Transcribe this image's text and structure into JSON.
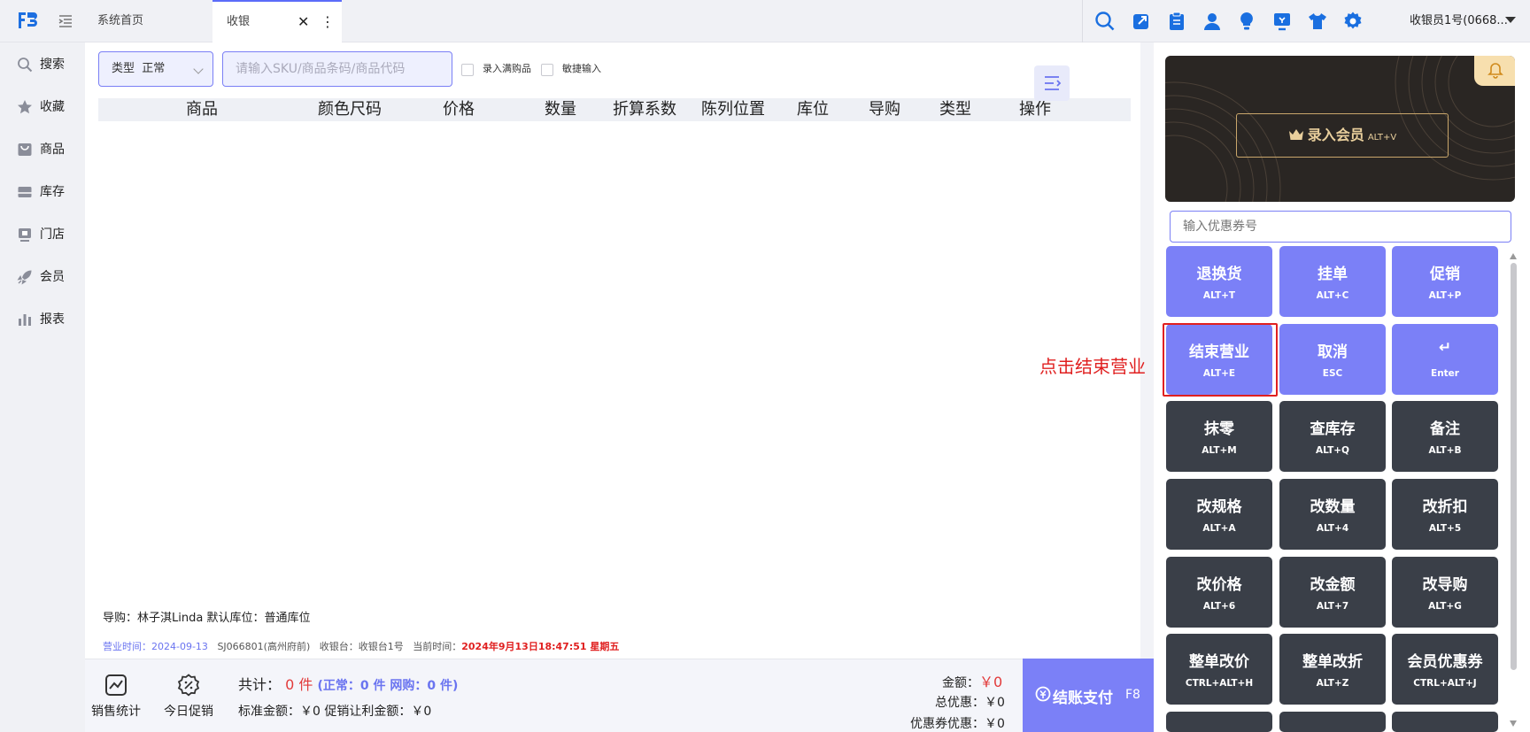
{
  "tabs": {
    "home": "系统首页",
    "active": "收银",
    "close": "✕",
    "more": "⋮"
  },
  "user": {
    "name": "收银员1号(0668..."
  },
  "sidebar": {
    "items": [
      {
        "label": "搜索",
        "icon": "search-icon"
      },
      {
        "label": "收藏",
        "icon": "star-icon"
      },
      {
        "label": "商品",
        "icon": "bag-icon"
      },
      {
        "label": "库存",
        "icon": "inventory-icon"
      },
      {
        "label": "门店",
        "icon": "store-icon"
      },
      {
        "label": "会员",
        "icon": "rocket-icon"
      },
      {
        "label": "报表",
        "icon": "bar-chart-icon"
      }
    ]
  },
  "toolbar": {
    "type_label": "类型",
    "type_value": "正常",
    "sku_placeholder": "请输入SKU/商品条码/商品代码",
    "check_full_gift": "录入满购品",
    "check_quick": "敏捷输入"
  },
  "table": {
    "headers": [
      "商品",
      "颜色尺码",
      "价格",
      "数量",
      "折算系数",
      "陈列位置",
      "库位",
      "导购",
      "类型",
      "操作"
    ]
  },
  "info": {
    "guide": "导购：林子淇Linda   默认库位：普通库位",
    "business_time_label": "营业时间：",
    "business_time": "2024-09-13",
    "store": "SJ066801(高州府前)",
    "register": "收银台：收银台1号",
    "current_time_label": "当前时间：",
    "current_time": "2024年9月13日18:47:51 星期五"
  },
  "bottom": {
    "sales_stats": "销售统计",
    "today_promo": "今日促销",
    "total_label": "共计：",
    "total_count": "0 件",
    "total_detail": "(正常：0 件  网购：0 件)",
    "standard_amount": "标准金额：￥0  促销让利金额：￥0",
    "amount_label": "金额：",
    "amount_value": "￥0",
    "total_discount_label": "总优惠：",
    "total_discount_value": "￥0",
    "coupon_discount_label": "优惠券优惠：",
    "coupon_discount_value": "￥0",
    "pay_label": "结账支付",
    "pay_key": "F8"
  },
  "right": {
    "member_label": "录入会员",
    "member_key": "ALT+V",
    "coupon_placeholder": "输入优惠券号",
    "keys": [
      {
        "label": "退换货",
        "key": "ALT+T",
        "style": "p"
      },
      {
        "label": "挂单",
        "key": "ALT+C",
        "style": "p"
      },
      {
        "label": "促销",
        "key": "ALT+P",
        "style": "p"
      },
      {
        "label": "结束营业",
        "key": "ALT+E",
        "style": "p"
      },
      {
        "label": "取消",
        "key": "ESC",
        "style": "p"
      },
      {
        "label": "↵",
        "key": "Enter",
        "style": "p"
      },
      {
        "label": "抹零",
        "key": "ALT+M",
        "style": "d"
      },
      {
        "label": "查库存",
        "key": "ALT+Q",
        "style": "d"
      },
      {
        "label": "备注",
        "key": "ALT+B",
        "style": "d"
      },
      {
        "label": "改规格",
        "key": "ALT+A",
        "style": "d"
      },
      {
        "label": "改数量",
        "key": "ALT+4",
        "style": "d"
      },
      {
        "label": "改折扣",
        "key": "ALT+5",
        "style": "d"
      },
      {
        "label": "改价格",
        "key": "ALT+6",
        "style": "d"
      },
      {
        "label": "改金额",
        "key": "ALT+7",
        "style": "d"
      },
      {
        "label": "改导购",
        "key": "ALT+G",
        "style": "d"
      },
      {
        "label": "整单改价",
        "key": "CTRL+ALT+H",
        "style": "d"
      },
      {
        "label": "整单改折",
        "key": "ALT+Z",
        "style": "d"
      },
      {
        "label": "会员优惠券",
        "key": "CTRL+ALT+J",
        "style": "d"
      }
    ]
  },
  "annotation": "点击结束营业",
  "colors": {
    "accent": "#7b80f7",
    "dark_key": "#3a3f48",
    "highlight": "#e02020"
  }
}
